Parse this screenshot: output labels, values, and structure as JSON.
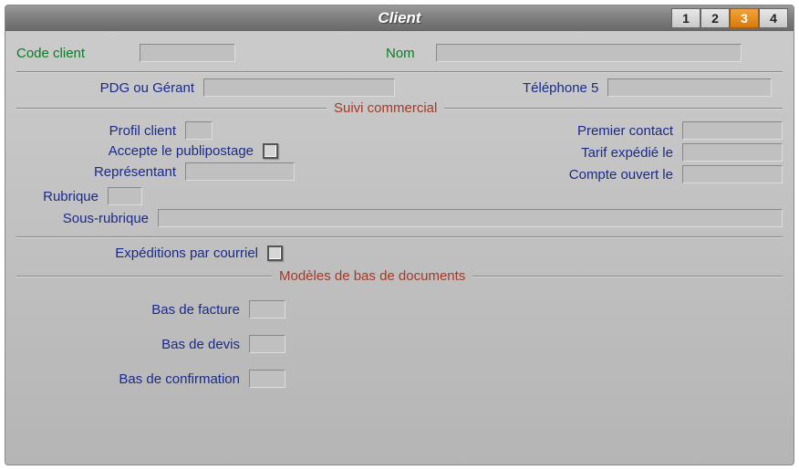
{
  "window": {
    "title": "Client",
    "tabs": [
      "1",
      "2",
      "3",
      "4"
    ],
    "active_tab": "3"
  },
  "header": {
    "code_client_label": "Code client",
    "code_client_value": "",
    "nom_label": "Nom",
    "nom_value": ""
  },
  "top_fields": {
    "pdg_label": "PDG ou Gérant",
    "pdg_value": "",
    "tel5_label": "Téléphone 5",
    "tel5_value": ""
  },
  "section_commercial": {
    "title": "Suivi commercial",
    "profil_label": "Profil client",
    "profil_value": "",
    "publipostage_label": "Accepte le publipostage",
    "publipostage_checked": false,
    "representant_label": "Représentant",
    "representant_value": "",
    "premier_contact_label": "Premier contact",
    "premier_contact_value": "",
    "tarif_label": "Tarif expédié le",
    "tarif_value": "",
    "compte_label": "Compte ouvert le",
    "compte_value": "",
    "rubrique_label": "Rubrique",
    "rubrique_value": "",
    "sous_rubrique_label": "Sous-rubrique",
    "sous_rubrique_value": ""
  },
  "section_email": {
    "expedition_label": "Expéditions par courriel",
    "expedition_checked": false
  },
  "section_models": {
    "title": "Modèles de bas de documents",
    "bas_facture_label": "Bas de facture",
    "bas_facture_value": "",
    "bas_devis_label": "Bas de devis",
    "bas_devis_value": "",
    "bas_confirmation_label": "Bas de confirmation",
    "bas_confirmation_value": ""
  }
}
